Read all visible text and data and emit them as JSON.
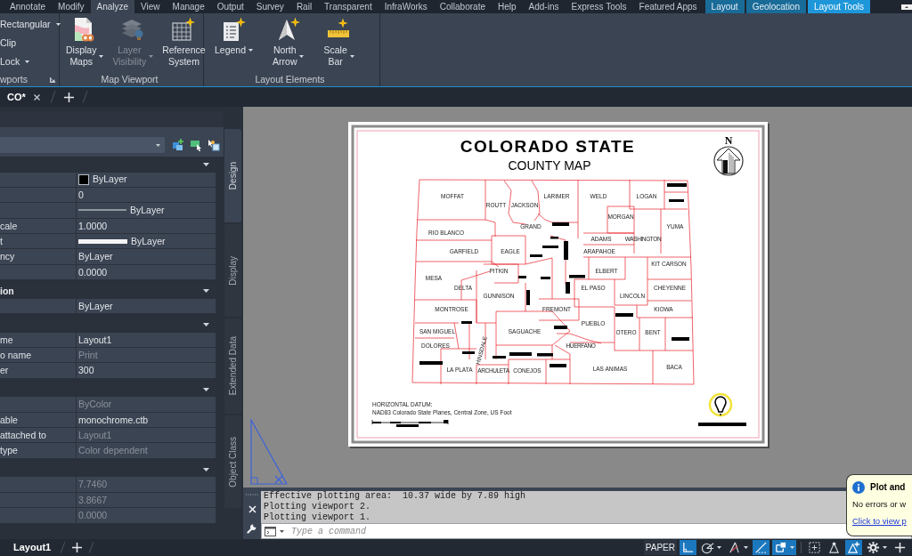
{
  "ribbon_tabs": [
    {
      "label": "Annotate",
      "kind": "standard",
      "selected": false,
      "hovered": false
    },
    {
      "label": "Modify",
      "kind": "standard",
      "selected": false,
      "hovered": false
    },
    {
      "label": "Analyze",
      "kind": "standard",
      "selected": false,
      "hovered": true
    },
    {
      "label": "View",
      "kind": "standard",
      "selected": false,
      "hovered": false
    },
    {
      "label": "Manage",
      "kind": "standard",
      "selected": false,
      "hovered": false
    },
    {
      "label": "Output",
      "kind": "standard",
      "selected": false,
      "hovered": false
    },
    {
      "label": "Survey",
      "kind": "standard",
      "selected": false,
      "hovered": false
    },
    {
      "label": "Rail",
      "kind": "standard",
      "selected": false,
      "hovered": false
    },
    {
      "label": "Transparent",
      "kind": "standard",
      "selected": false,
      "hovered": false
    },
    {
      "label": "InfraWorks",
      "kind": "standard",
      "selected": false,
      "hovered": false
    },
    {
      "label": "Collaborate",
      "kind": "standard",
      "selected": false,
      "hovered": false
    },
    {
      "label": "Help",
      "kind": "standard",
      "selected": false,
      "hovered": false
    },
    {
      "label": "Add-ins",
      "kind": "standard",
      "selected": false,
      "hovered": false
    },
    {
      "label": "Express Tools",
      "kind": "standard",
      "selected": false,
      "hovered": false
    },
    {
      "label": "Featured Apps",
      "kind": "standard",
      "selected": false,
      "hovered": false
    },
    {
      "label": "Layout",
      "kind": "contextual",
      "selected": false,
      "hovered": false
    },
    {
      "label": "Geolocation",
      "kind": "contextual",
      "selected": false,
      "hovered": false
    },
    {
      "label": "Layout Tools",
      "kind": "contextual",
      "selected": true,
      "hovered": false
    }
  ],
  "ribbon_panels": [
    {
      "title": "wports",
      "kind": "small",
      "launcher": true,
      "items": [
        {
          "label": "Rectangular",
          "dropdown": true
        },
        {
          "label": "Clip",
          "dropdown": false
        },
        {
          "label": "Lock",
          "dropdown": true
        }
      ]
    },
    {
      "title": "Map Viewport",
      "kind": "large",
      "launcher": false,
      "items": [
        {
          "label": "Display Maps",
          "kind": "display-maps",
          "dropdown": true,
          "disabled": false
        },
        {
          "label": "Layer Visibility",
          "kind": "layer-visibility",
          "dropdown": true,
          "disabled": true
        },
        {
          "label": "Reference System",
          "kind": "reference-system",
          "dropdown": false,
          "disabled": false
        }
      ]
    },
    {
      "title": "Layout Elements",
      "kind": "large",
      "launcher": false,
      "items": [
        {
          "label": "Legend",
          "kind": "legend",
          "dropdown": true,
          "disabled": false
        },
        {
          "label": "North Arrow",
          "kind": "north-arrow",
          "dropdown": true,
          "disabled": false
        },
        {
          "label": "Scale Bar",
          "kind": "scale-bar",
          "dropdown": true,
          "disabled": false
        }
      ]
    }
  ],
  "document_tabs": [
    {
      "label": "CO*",
      "selected": true
    }
  ],
  "properties": {
    "sections": [
      {
        "expanded": true,
        "rows": [
          {
            "kind": "color",
            "value": "ByLayer",
            "color": "#000000",
            "disabled": false
          },
          {
            "kind": "text",
            "value": "0",
            "disabled": false
          },
          {
            "kind": "linetype",
            "value": "ByLayer",
            "disabled": false
          },
          {
            "kind": "text",
            "label": "cale",
            "value": "1.0000",
            "disabled": false
          },
          {
            "kind": "lineweight",
            "label": "t",
            "value": "ByLayer",
            "disabled": false
          },
          {
            "kind": "text",
            "label": "ncy",
            "value": "ByLayer",
            "disabled": false
          },
          {
            "kind": "text",
            "value": "0.0000",
            "disabled": false
          }
        ]
      },
      {
        "title": "ion",
        "expanded": true,
        "rows": [
          {
            "kind": "text",
            "value": "ByLayer",
            "disabled": false
          }
        ]
      },
      {
        "expanded": true,
        "rows": [
          {
            "kind": "text",
            "label": "me",
            "value": "Layout1",
            "disabled": false
          },
          {
            "kind": "text",
            "label": "o name",
            "value": "Print",
            "disabled": true
          },
          {
            "kind": "text",
            "label": "er",
            "value": "300",
            "disabled": false
          }
        ]
      },
      {
        "expanded": true,
        "rows": [
          {
            "kind": "text",
            "value": "ByColor",
            "disabled": true
          },
          {
            "kind": "text",
            "label": "able",
            "value": "monochrome.ctb",
            "disabled": false
          },
          {
            "kind": "text",
            "label": "attached to",
            "value": "Layout1",
            "disabled": true
          },
          {
            "kind": "text",
            "label": "type",
            "value": "Color dependent",
            "disabled": true
          }
        ]
      },
      {
        "expanded": true,
        "rows": [
          {
            "kind": "text",
            "value": "7.7460",
            "disabled": true
          },
          {
            "kind": "text",
            "value": "3.8667",
            "disabled": true
          },
          {
            "kind": "text",
            "value": "0.0000",
            "disabled": true
          }
        ]
      }
    ],
    "side_tabs": [
      {
        "label": "Design",
        "selected": true
      },
      {
        "label": "Display",
        "selected": false
      },
      {
        "label": "Extended Data",
        "selected": false
      },
      {
        "label": "Object Class",
        "selected": false
      }
    ]
  },
  "layout_sheet": {
    "title": "COLORADO STATE",
    "subtitle": "COUNTY MAP",
    "north_label": "N",
    "county_labels": [
      "MOFFAT",
      "LARIMER",
      "WELD",
      "LOGAN",
      "ROUTT",
      "JACKSON",
      "MORGAN",
      "GRAND",
      "YUMA",
      "RIO BLANCO",
      "ADAMS",
      "WASHINGTON",
      "GARFIELD",
      "EAGLE",
      "ARAPAHOE",
      "KIT CARSON",
      "PITKIN",
      "ELBERT",
      "MESA",
      "DELTA",
      "EL PASO",
      "CHEYENNE",
      "GUNNISON",
      "LINCOLN",
      "MONTROSE",
      "FREMONT",
      "KIOWA",
      "PUEBLO",
      "SAN MIGUEL",
      "SAGUACHE",
      "OTERO",
      "BENT",
      "DOLORES",
      "HINSDALE",
      "HUERFANO",
      "LA PLATA",
      "ARCHULETA",
      "CONEJOS",
      "LAS ANIMAS",
      "BACA"
    ],
    "datum_heading": "HORIZONTAL DATUM:",
    "datum_text": "NAD83 Colorado State Planes, Central Zone, US Foot"
  },
  "command_line": {
    "history": [
      "Effective plotting area:  10.37 wide by 7.89 high",
      "Plotting viewport 2.",
      "Plotting viewport 1."
    ],
    "placeholder": "Type a command"
  },
  "notification": {
    "title": "Plot and",
    "message": "No errors or w",
    "link": "Click to view p"
  },
  "layout_tabs": [
    {
      "label": "Layout1",
      "selected": true
    }
  ],
  "status_bar": {
    "space": "PAPER",
    "toggles": [
      {
        "kind": "ortho",
        "on": true,
        "dropdown": false
      },
      {
        "kind": "polar",
        "on": false,
        "dropdown": true
      },
      {
        "kind": "isodraft",
        "on": false,
        "dropdown": true
      },
      {
        "kind": "otrack",
        "on": true,
        "dropdown": false
      },
      {
        "kind": "osnap",
        "on": true,
        "dropdown": true
      },
      {
        "kind": "selection-cycling",
        "on": false,
        "dropdown": false
      },
      {
        "kind": "annotation-visibility",
        "on": false,
        "dropdown": false
      },
      {
        "kind": "auto-scale",
        "on": true,
        "dropdown": false
      },
      {
        "kind": "settings",
        "on": false,
        "dropdown": true
      },
      {
        "kind": "customize",
        "on": false,
        "dropdown": false
      }
    ]
  }
}
